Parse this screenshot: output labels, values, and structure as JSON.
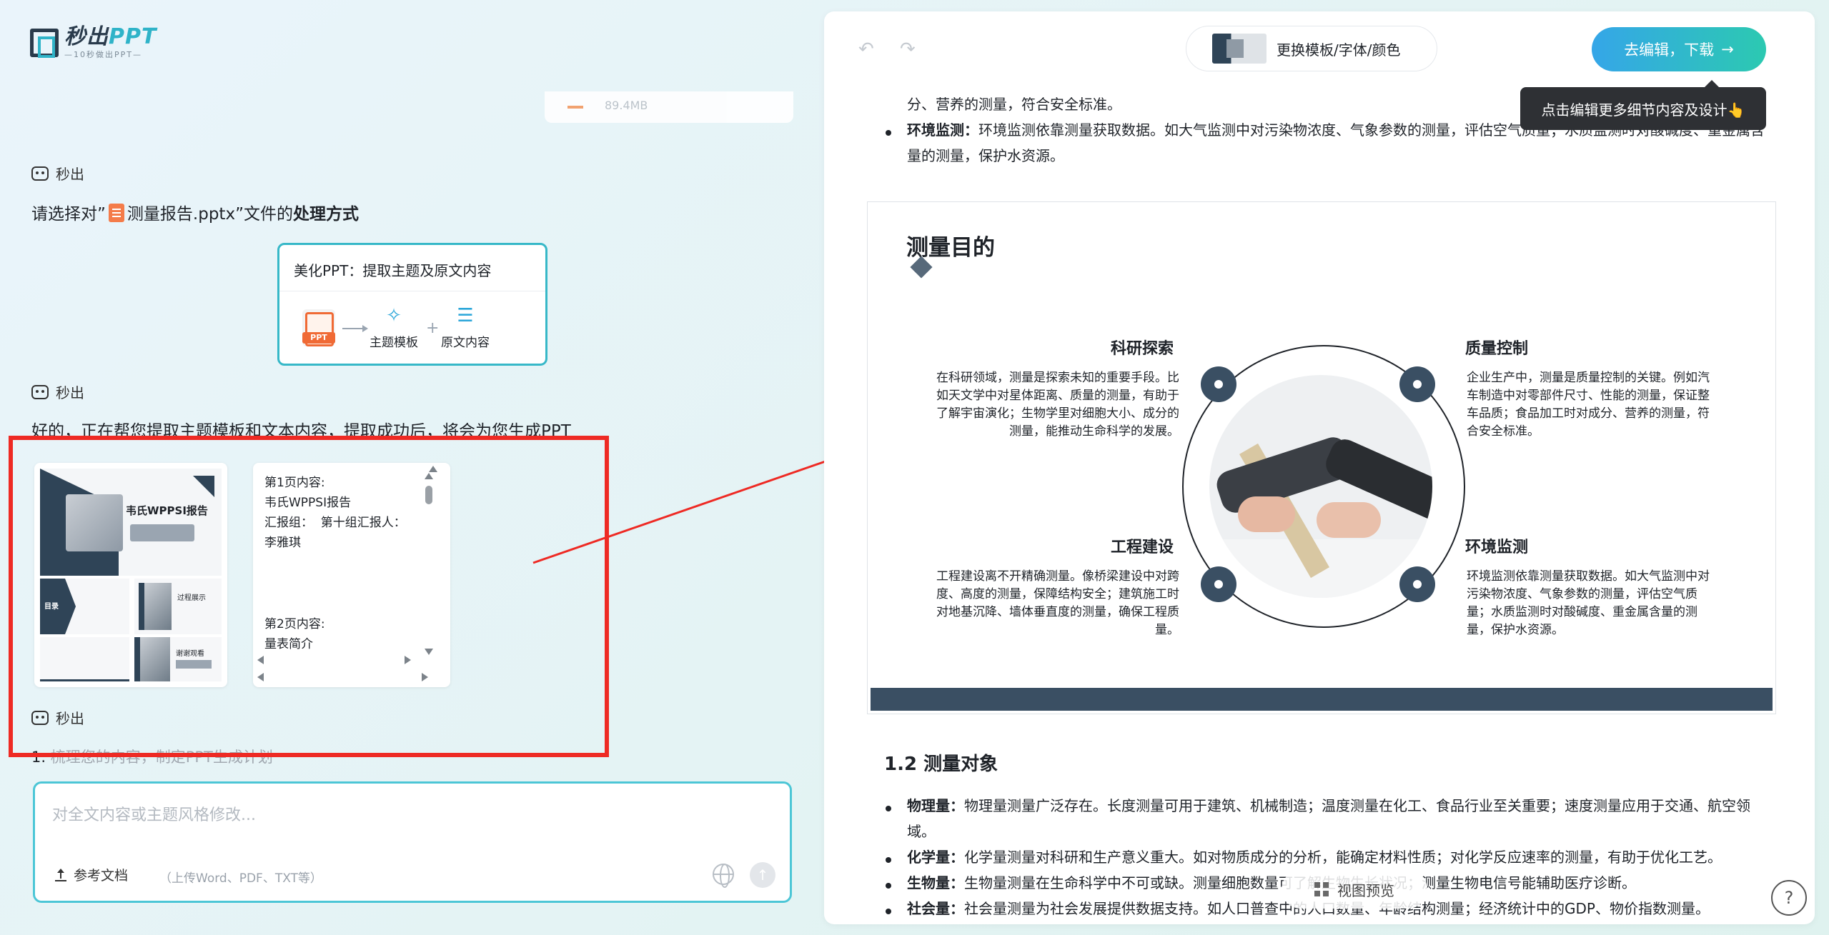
{
  "brand": {
    "name": "秒出",
    "name_ppt": "PPT",
    "tagline": "—10秒做出PPT—"
  },
  "file_stub": {
    "size": "89.4MB"
  },
  "messages": [
    {
      "sender": "秒出"
    },
    {
      "sender": "秒出"
    },
    {
      "sender": "秒出"
    }
  ],
  "choose": {
    "prefix": "请选择对”",
    "filename": "测量报告.pptx",
    "suffix": "”文件的",
    "bold": "处理方式"
  },
  "option_card": {
    "title": "美化PPT：提取主题及原文内容",
    "ppt_label": "PPT",
    "item1": "主题模板",
    "plus": "+",
    "item2": "原文内容"
  },
  "status_msg": "好的，正在帮您提取主题模板和文本内容，提取成功后，将会为您生成PPT",
  "thumbnails": {
    "slide1_title": "韦氏WPPSI报告",
    "slide2_title": "目录",
    "slide3_title": "过程展示",
    "slide5_title": "谢谢观看"
  },
  "text_preview": {
    "page1_heading": "第1页内容:",
    "page1_lines": "韦氏WPPSI报告\n汇报组：  第十组汇报人：  李雅琪",
    "page2_heading": "第2页内容:",
    "page2_line": "量表简介"
  },
  "plan_line": {
    "num": "1.",
    "text": "梳理您的内容，制定PPT生成计划"
  },
  "input": {
    "placeholder": "对全文内容或主题风格修改...",
    "ref_label": "参考文档",
    "ref_hint": "（上传Word、PDF、TXT等）"
  },
  "toolbar": {
    "undo": "↶",
    "redo": "↷",
    "template_label": "更换模板/字体/颜色",
    "go_label": "去编辑，下载",
    "go_arrow": "→",
    "tooltip": "点击编辑更多细节内容及设计👆"
  },
  "doc_top": {
    "line1": "分、营养的测量，符合安全标准。",
    "env_label": "环境监测：",
    "env_text": "环境监测依靠测量获取数据。如大气监测中对污染物浓度、气象参数的测量，评估空气质量；水质监测时对酸碱度、重金属含量的测量，保护水资源。"
  },
  "slide": {
    "title": "测量目的",
    "q1_title": "科研探索",
    "q1_body": "在科研领域，测量是探索未知的重要手段。比如天文学中对星体距离、质量的测量，有助于了解宇宙演化；生物学里对细胞大小、成分的测量，能推动生命科学的发展。",
    "q2_title": "质量控制",
    "q2_body": "企业生产中，测量是质量控制的关键。例如汽车制造中对零部件尺寸、性能的测量，保证整车品质；食品加工时对成分、营养的测量，符合安全标准。",
    "q3_title": "工程建设",
    "q3_body": "工程建设离不开精确测量。像桥梁建设中对跨度、高度的测量，保障结构安全；建筑施工时对地基沉降、墙体垂直度的测量，确保工程质量。",
    "q4_title": "环境监测",
    "q4_body": "环境监测依靠测量获取数据。如大气监测中对污染物浓度、气象参数的测量，评估空气质量；水质监测时对酸碱度、重金属含量的测量，保护水资源。"
  },
  "section": {
    "title": "1.2 测量对象",
    "items": [
      {
        "label": "物理量：",
        "text": "物理量测量广泛存在。长度测量可用于建筑、机械制造；温度测量在化工、食品行业至关重要；速度测量应用于交通、航空领域。"
      },
      {
        "label": "化学量：",
        "text": "化学量测量对科研和生产意义重大。如对物质成分的分析，能确定材料性质；对化学反应速率的测量，有助于优化工艺。"
      },
      {
        "label": "生物量：",
        "text": "生物量测量在生命科学中不可或缺。测量细胞数量可了解生物生长状况；测量生物电信号能辅助医疗诊断。"
      },
      {
        "label": "社会量：",
        "text": "社会量测量为社会发展提供数据支持。如人口普查中的人口数量、年龄结构测量；经济统计中的GDP、物价指数测量。"
      }
    ]
  },
  "view_preview": "视图预览",
  "help": "?",
  "colors": {
    "accent": "#37b8c8",
    "slide_dark": "#3a4f63",
    "annotation_red": "#ee2a24"
  }
}
